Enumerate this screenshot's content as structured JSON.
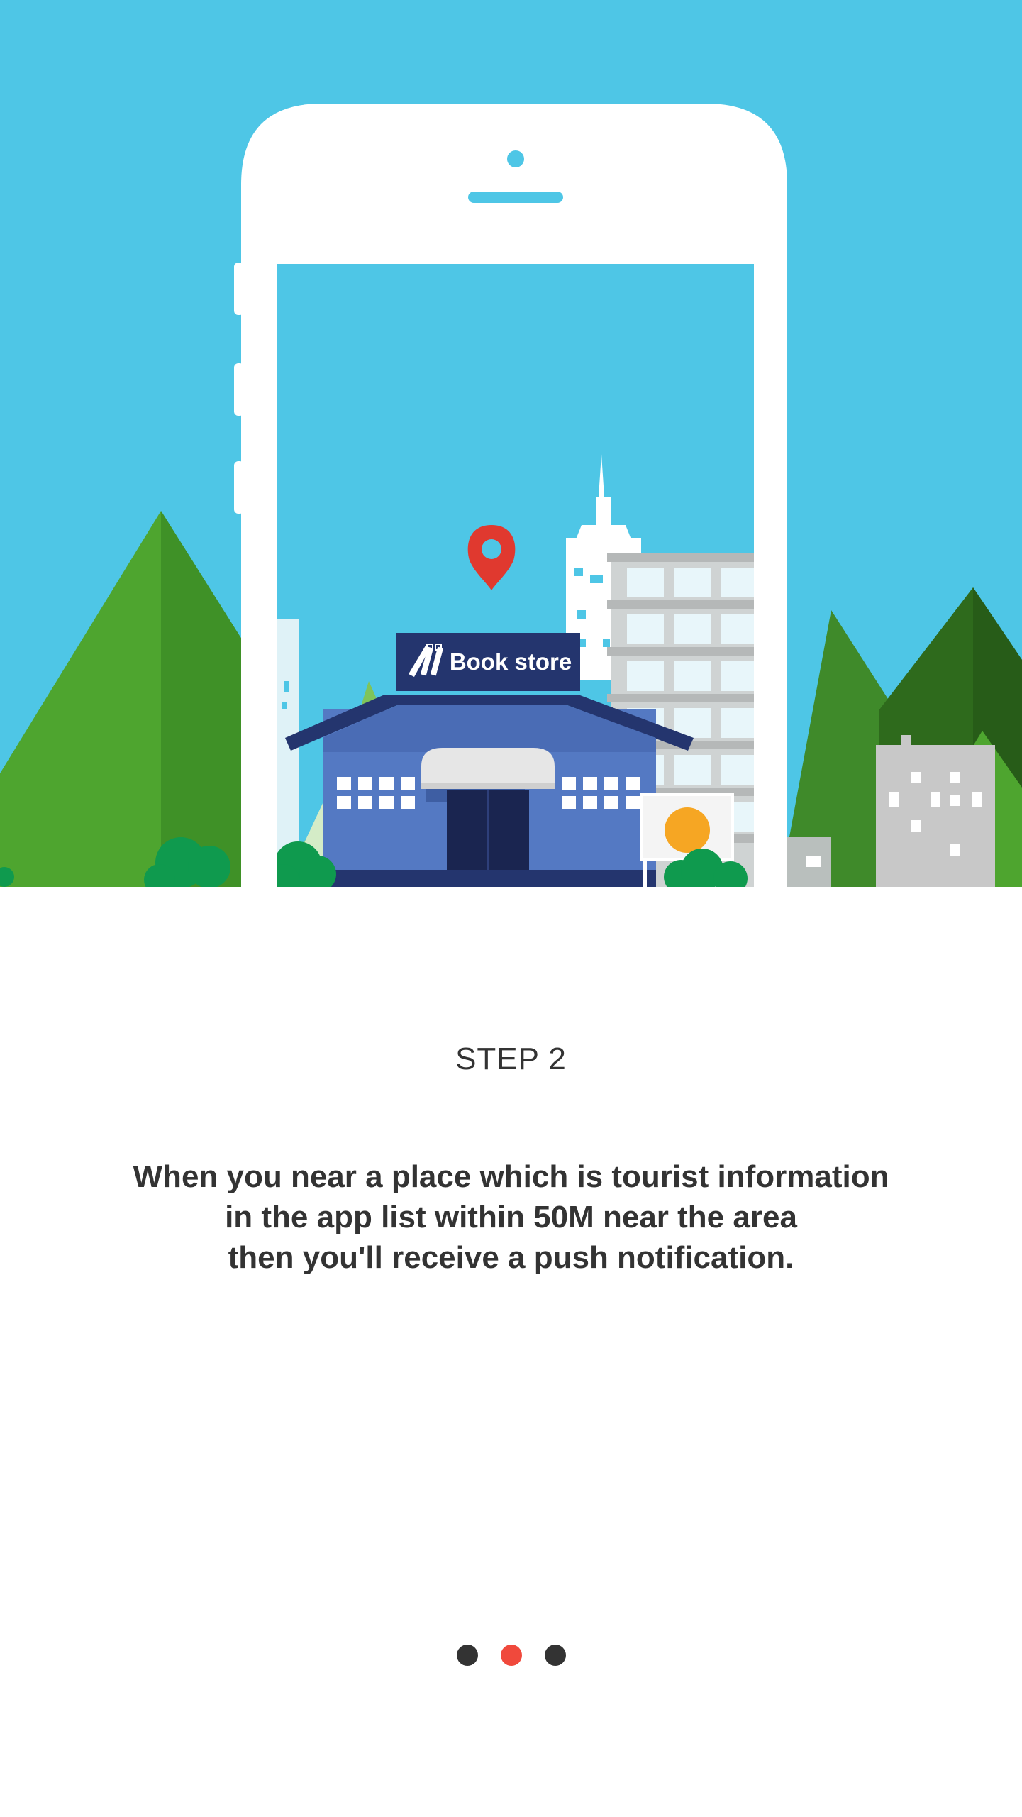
{
  "illustration": {
    "sign_text": "Book store",
    "icons": [
      "phone-icon",
      "location-pin-icon",
      "bookstore-icon",
      "books-icon"
    ]
  },
  "step": {
    "title": "STEP 2",
    "description_lines": [
      "When you near a place which is tourist information",
      "in the app list within 50M near the area",
      "then you'll receive a push notification."
    ]
  },
  "pager": {
    "total": 3,
    "active_index": 1
  },
  "colors": {
    "sky": "#4ec6e6",
    "accent_red": "#f0493c",
    "text": "#333333",
    "dot_inactive": "#333333",
    "bookstore_blue": "#5479c3",
    "bookstore_navy": "#24356e"
  }
}
